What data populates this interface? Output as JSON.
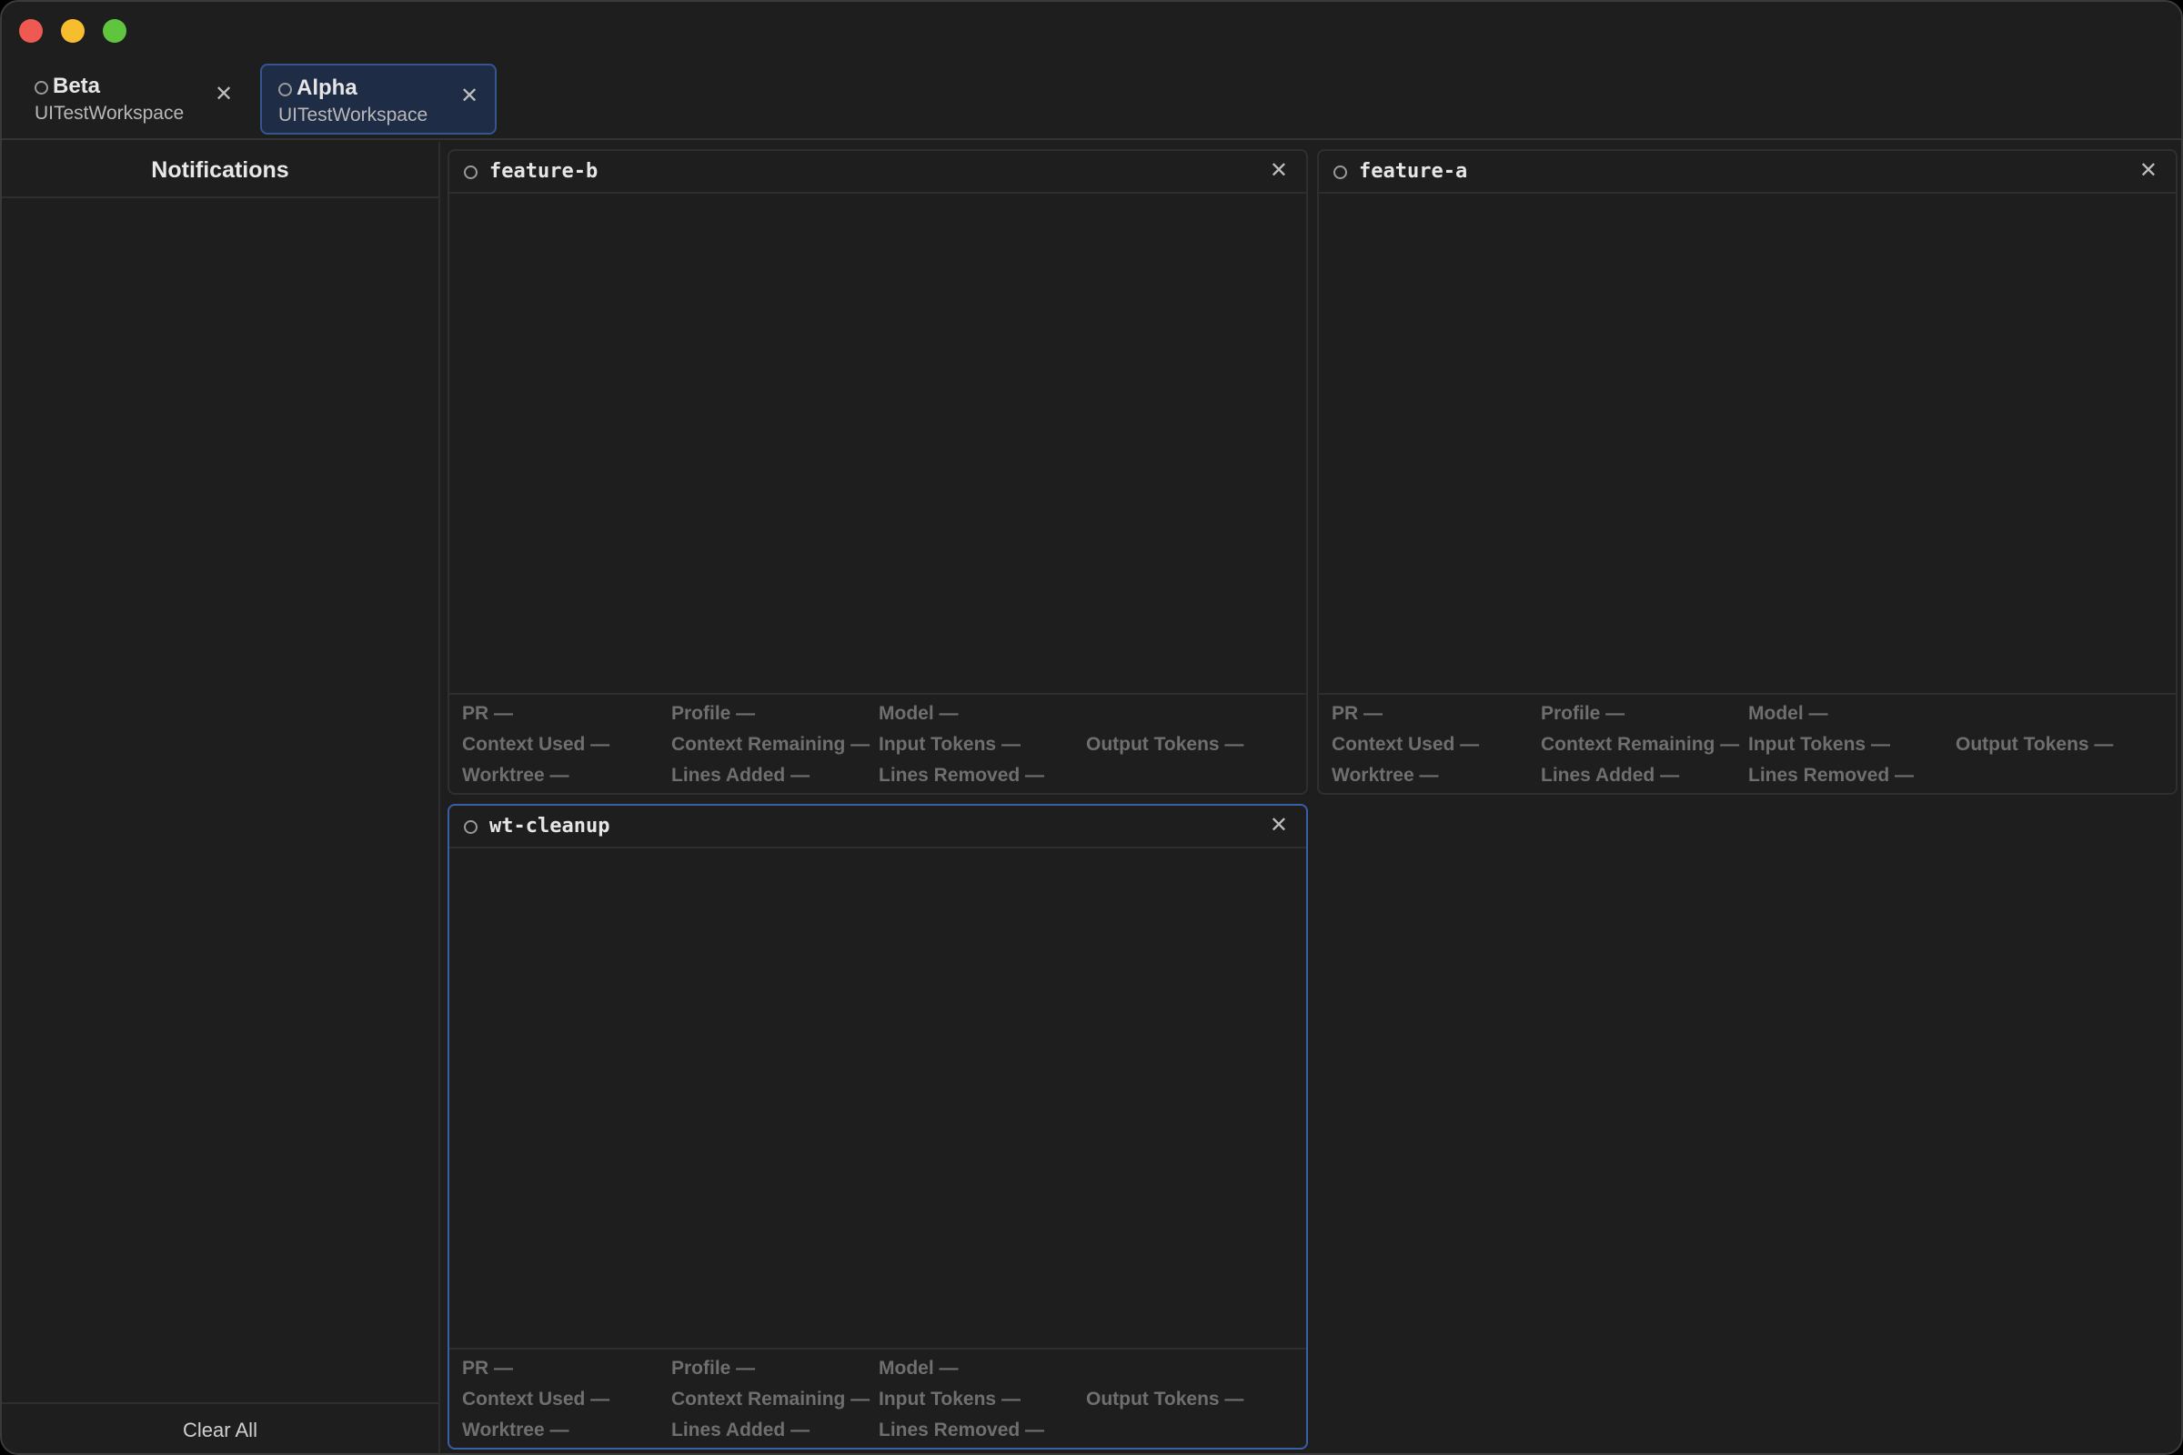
{
  "window": {
    "tabs": [
      {
        "name": "Beta",
        "workspace": "UITestWorkspace",
        "active": false
      },
      {
        "name": "Alpha",
        "workspace": "UITestWorkspace",
        "active": true
      }
    ]
  },
  "sidebar": {
    "title": "Notifications",
    "clear_all_label": "Clear All"
  },
  "panes": [
    {
      "title": "feature-b",
      "focused": false,
      "stats": {
        "pr": "PR —",
        "profile": "Profile —",
        "model": "Model —",
        "context_used": "Context Used —",
        "context_remaining": "Context Remaining —",
        "input_tokens": "Input Tokens —",
        "output_tokens": "Output Tokens —",
        "worktree": "Worktree —",
        "lines_added": "Lines Added —",
        "lines_removed": "Lines Removed —"
      }
    },
    {
      "title": "feature-a",
      "focused": false,
      "stats": {
        "pr": "PR —",
        "profile": "Profile —",
        "model": "Model —",
        "context_used": "Context Used —",
        "context_remaining": "Context Remaining —",
        "input_tokens": "Input Tokens —",
        "output_tokens": "Output Tokens —",
        "worktree": "Worktree —",
        "lines_added": "Lines Added —",
        "lines_removed": "Lines Removed —"
      }
    },
    {
      "title": "wt-cleanup",
      "focused": true,
      "stats": {
        "pr": "PR —",
        "profile": "Profile —",
        "model": "Model —",
        "context_used": "Context Used —",
        "context_remaining": "Context Remaining —",
        "input_tokens": "Input Tokens —",
        "output_tokens": "Output Tokens —",
        "worktree": "Worktree —",
        "lines_added": "Lines Added —",
        "lines_removed": "Lines Removed —"
      }
    }
  ],
  "colors": {
    "background": "#1e1e1e",
    "focus_border": "#3a5fa8",
    "active_tab_bg": "#1f2c45",
    "stat_text": "#6f6f6f"
  },
  "icons": {
    "close": "close-icon",
    "status": "status-circle-icon"
  }
}
